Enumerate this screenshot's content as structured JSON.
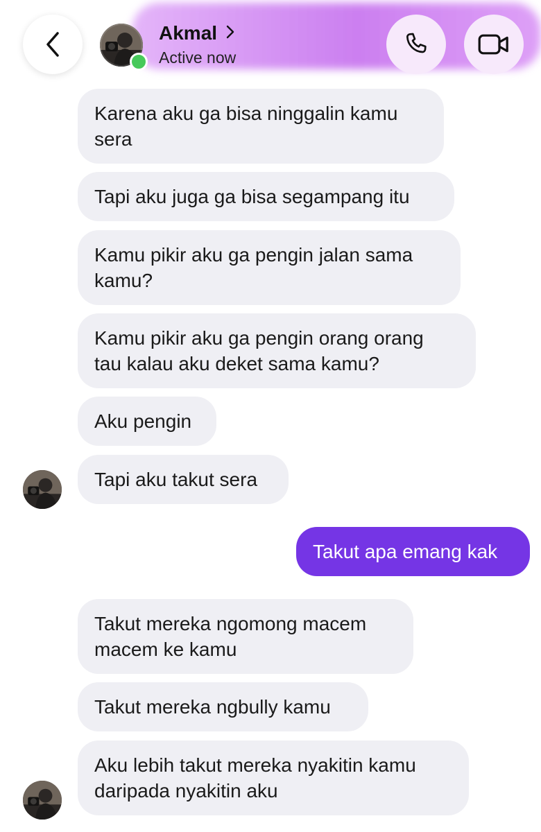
{
  "header": {
    "contact_name": "Akmal",
    "status": "Active now",
    "accent_color": "#c978ef",
    "icons": {
      "back": "chevron-left-icon",
      "name_chevron": "chevron-right-icon",
      "phone": "phone-icon",
      "video": "video-camera-icon"
    }
  },
  "messages": [
    {
      "sender": "contact",
      "text_lines": [
        "Karena aku ga bisa ninggalin kamu",
        "sera"
      ]
    },
    {
      "sender": "contact",
      "text_lines": [
        "Tapi aku juga ga bisa segampang itu"
      ]
    },
    {
      "sender": "contact",
      "text_lines": [
        "Kamu pikir aku ga pengin jalan sama",
        "kamu?"
      ]
    },
    {
      "sender": "contact",
      "text_lines": [
        "Kamu pikir aku ga pengin orang orang",
        "tau kalau aku deket sama kamu?"
      ]
    },
    {
      "sender": "contact",
      "text_lines": [
        "Aku pengin"
      ]
    },
    {
      "sender": "contact",
      "text_lines": [
        "Tapi aku takut sera"
      ]
    },
    {
      "sender": "me",
      "text_lines": [
        "Takut apa emang kak"
      ]
    },
    {
      "sender": "contact",
      "text_lines": [
        "Takut mereka ngomong macem",
        "macem ke kamu"
      ]
    },
    {
      "sender": "contact",
      "text_lines": [
        "Takut mereka ngbully kamu"
      ]
    },
    {
      "sender": "contact",
      "text_lines": [
        "Aku lebih takut mereka nyakitin kamu",
        "daripada nyakitin aku"
      ]
    }
  ],
  "colors": {
    "incoming_bubble": "#efeff4",
    "outgoing_bubble": "#7535e5",
    "online": "#47c95b"
  }
}
